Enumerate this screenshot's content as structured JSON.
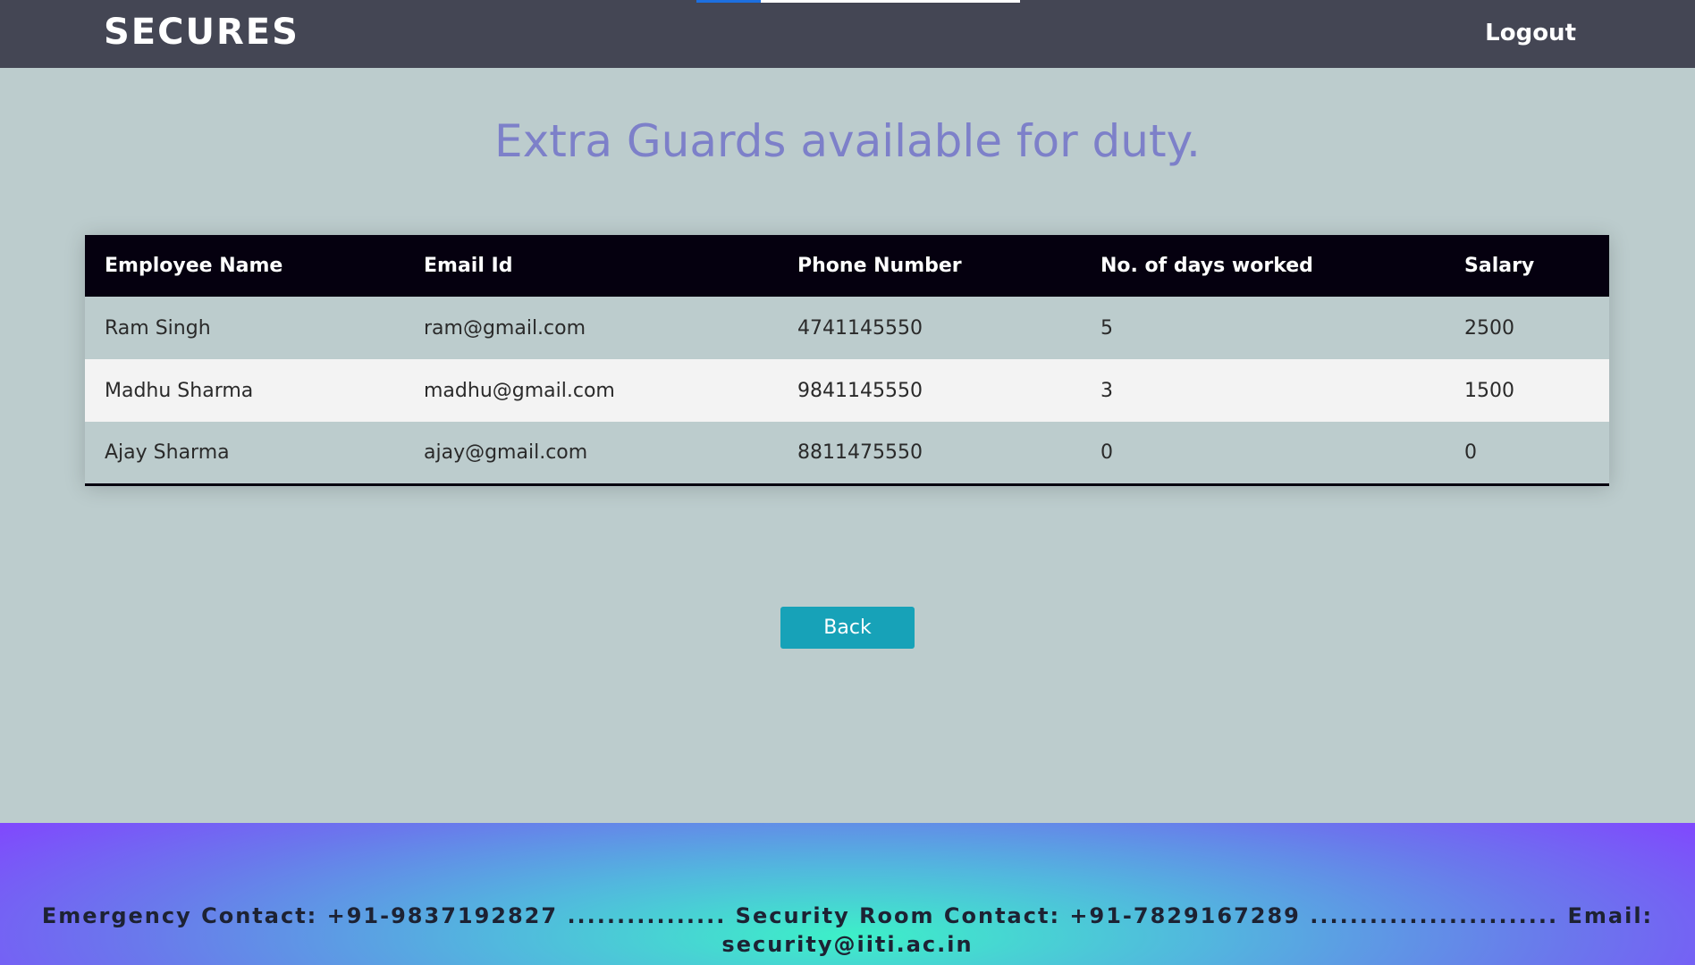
{
  "navbar": {
    "brand": "SECURES",
    "logout_label": "Logout"
  },
  "page": {
    "title": "Extra Guards available for duty."
  },
  "table": {
    "headers": [
      "Employee Name",
      "Email Id",
      "Phone Number",
      "No. of days worked",
      "Salary"
    ],
    "rows": [
      [
        "Ram Singh",
        "ram@gmail.com",
        "4741145550",
        "5",
        "2500"
      ],
      [
        "Madhu Sharma",
        "madhu@gmail.com",
        "9841145550",
        "3",
        "1500"
      ],
      [
        "Ajay Sharma",
        "ajay@gmail.com",
        "8811475550",
        "0",
        "0"
      ]
    ]
  },
  "actions": {
    "back_label": "Back"
  },
  "footer": {
    "text": "Emergency Contact: +91-9837192827 ................ Security Room Contact: +91-7829167289 ......................... Email: security@iiti.ac.in"
  },
  "colors": {
    "navbar": "#444654",
    "background": "#bccccd",
    "title": "#7d80c9",
    "table_header": "#05000f",
    "button": "#17a2b8"
  }
}
